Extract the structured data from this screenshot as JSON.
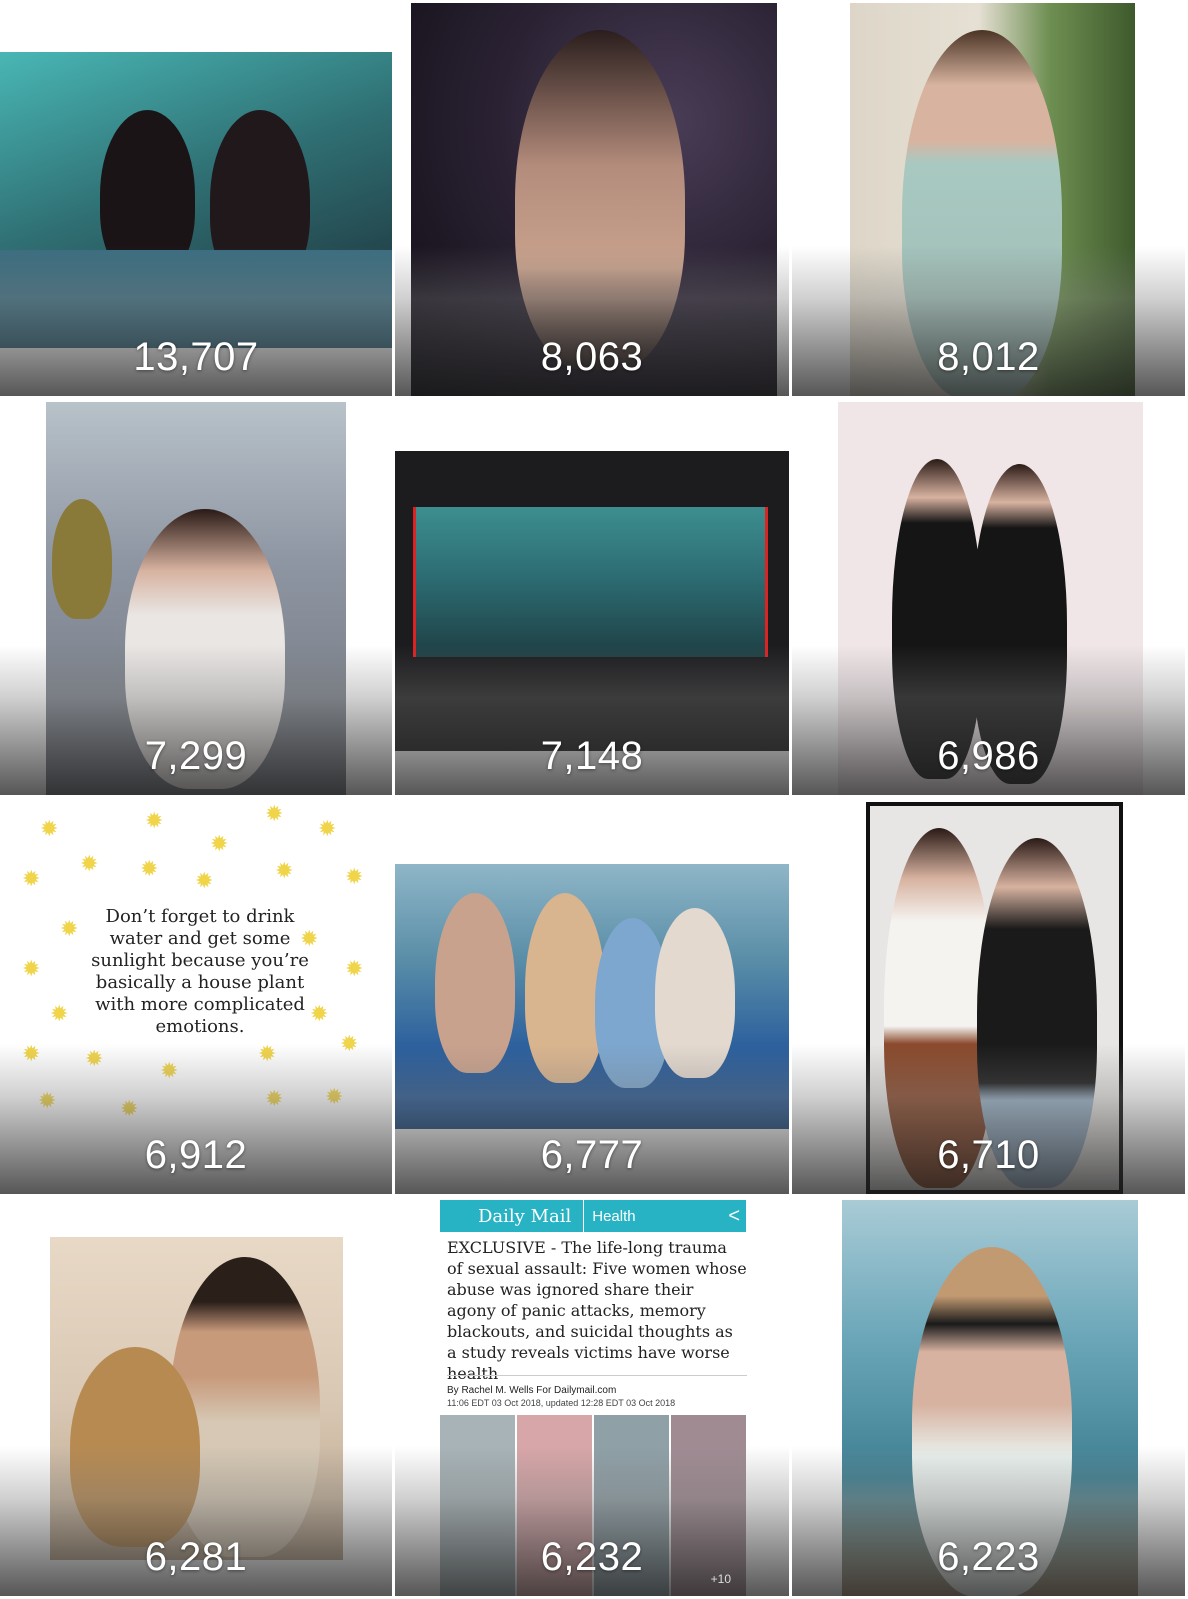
{
  "grid": {
    "tiles": [
      {
        "count": "13,707",
        "alt": "",
        "bg": "#2f6f73",
        "accent": "#1b2a33"
      },
      {
        "count": "8,063",
        "alt": "",
        "bg": "#2a2233",
        "accent": "#0e0b12"
      },
      {
        "count": "8,012",
        "alt": "",
        "bg": "#cfd7cf",
        "accent": "#9cb9b2"
      },
      {
        "count": "7,299",
        "alt": "",
        "bg": "#8e96a3",
        "accent": "#e9e6e4"
      },
      {
        "count": "7,148",
        "alt": "",
        "bg": "#1c1c1e",
        "accent": "#2b6a70"
      },
      {
        "count": "6,986",
        "alt": "",
        "bg": "#f0e6e8",
        "accent": "#151515"
      },
      {
        "count": "6,912",
        "quote": "Don’t forget to drink water and get some sunlight because you’re basically a house plant with more complicated emotions.",
        "bg": "#ffffff",
        "sun_color": "#f0d44a"
      },
      {
        "count": "6,777",
        "alt": "",
        "bg": "#5b8fa8",
        "accent": "#2b5f9d"
      },
      {
        "count": "6,710",
        "alt": "",
        "bg": "#e8e6e4",
        "accent": "#1a1a1a"
      },
      {
        "count": "6,281",
        "alt": "",
        "bg": "#d9c8b4",
        "accent": "#2b1f1a"
      },
      {
        "count": "6,232",
        "bg": "#ffffff",
        "article": {
          "logo": "Daily Mail",
          "section": "Health",
          "headline": "EXCLUSIVE - The life-long trauma of sexual assault: Five women whose abuse was ignored share their agony of panic attacks, memory blackouts, and suicidal thoughts as a study reveals victims have worse health",
          "byline": "By Rachel M. Wells For Dailymail.com",
          "timestamp": "11:06 EDT 03 Oct 2018, updated 12:28 EDT 03 Oct 2018",
          "photo_count": "+10",
          "bar_color": "#27b3c4"
        }
      },
      {
        "count": "6,223",
        "alt": "",
        "bg": "#6aa6b8",
        "accent": "#d9c3a3"
      }
    ]
  }
}
